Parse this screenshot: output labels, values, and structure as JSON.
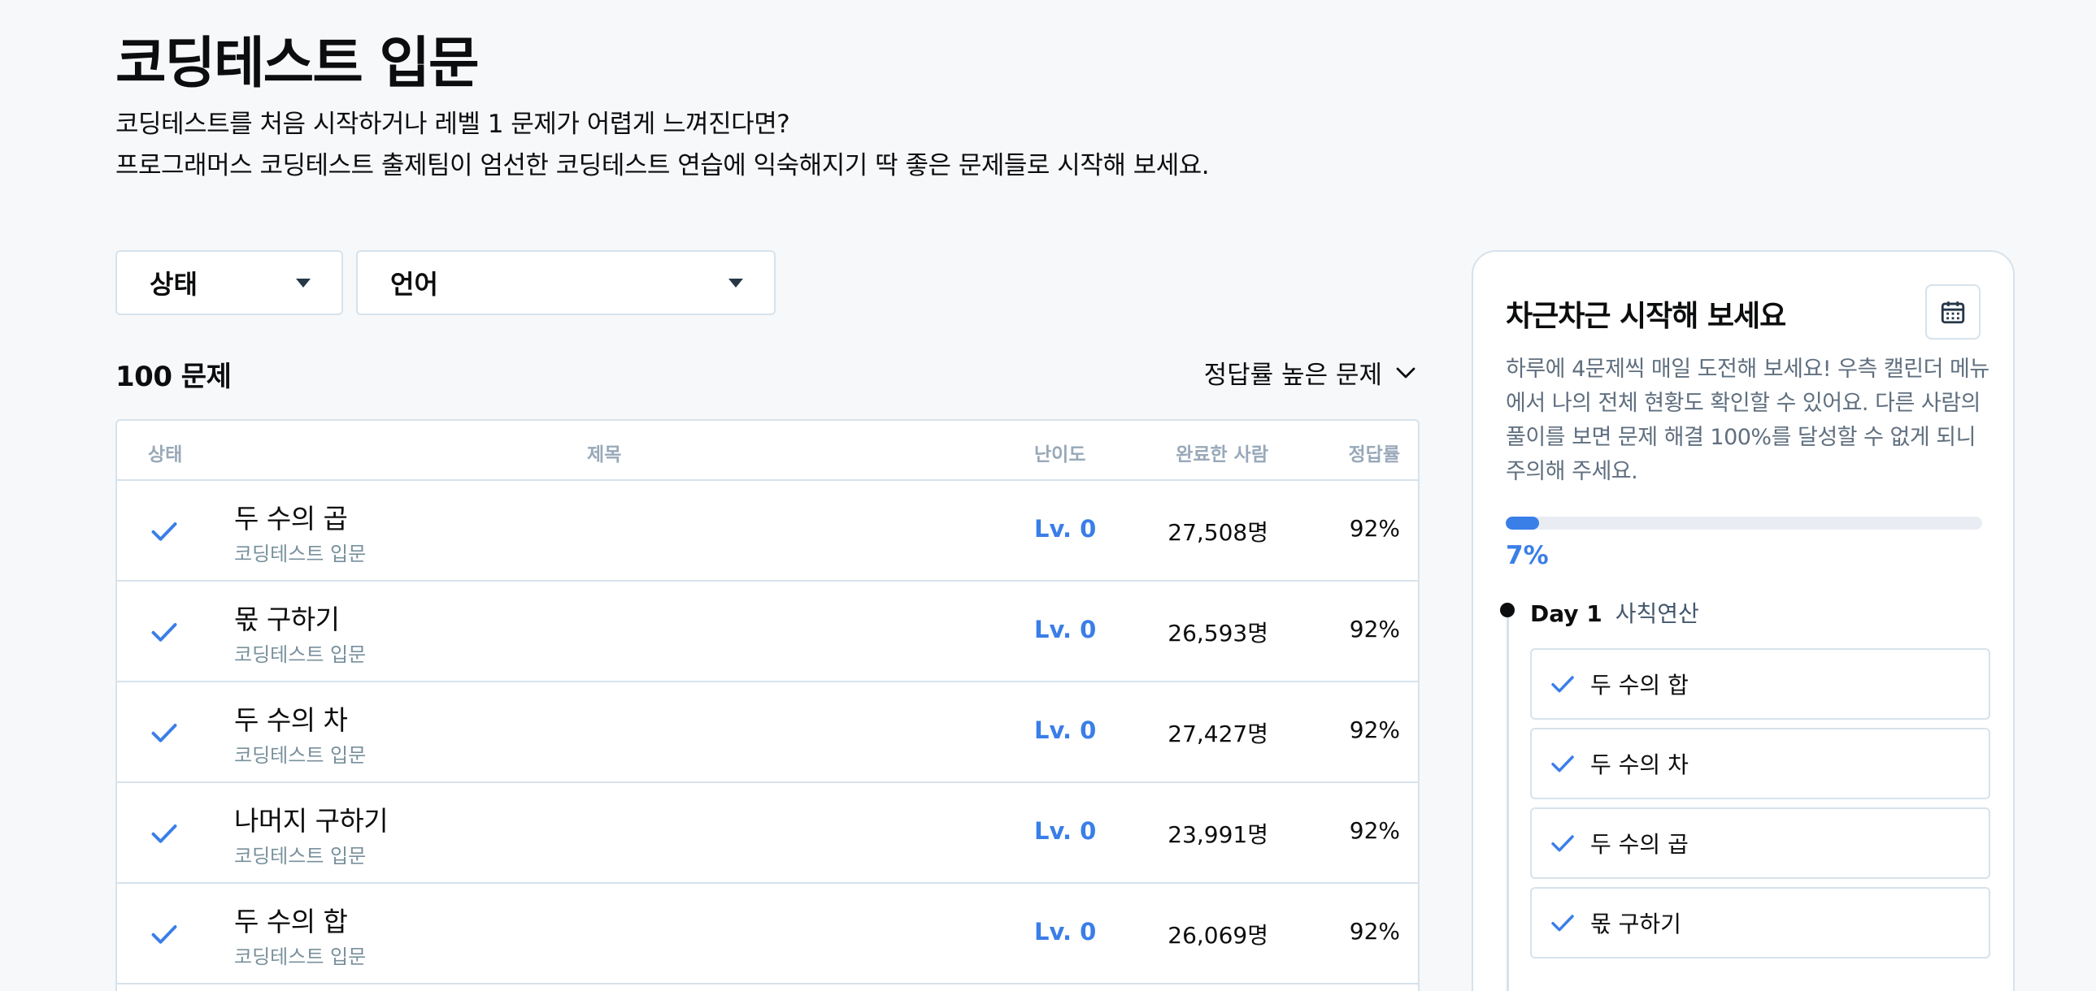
{
  "page": {
    "title": "코딩테스트 입문",
    "description_lines": [
      "코딩테스트를 처음 시작하거나 레벨 1 문제가 어렵게 느껴진다면?",
      "프로그래머스 코딩테스트 출제팀이 엄선한 코딩테스트 연습에 익숙해지기 딱 좋은 문제들로 시작해 보세요."
    ]
  },
  "filters": {
    "status_label": "상태",
    "language_label": "언어"
  },
  "list": {
    "count_label": "100 문제",
    "sort_label": "정답률 높은 문제"
  },
  "table": {
    "headers": {
      "status": "상태",
      "title": "제목",
      "level": "난이도",
      "completed": "완료한 사람",
      "rate": "정답률"
    },
    "rows": [
      {
        "title": "두 수의 곱",
        "category": "코딩테스트 입문",
        "level": "Lv. 0",
        "completed": "27,508명",
        "rate": "92%"
      },
      {
        "title": "몫 구하기",
        "category": "코딩테스트 입문",
        "level": "Lv. 0",
        "completed": "26,593명",
        "rate": "92%"
      },
      {
        "title": "두 수의 차",
        "category": "코딩테스트 입문",
        "level": "Lv. 0",
        "completed": "27,427명",
        "rate": "92%"
      },
      {
        "title": "나머지 구하기",
        "category": "코딩테스트 입문",
        "level": "Lv. 0",
        "completed": "23,991명",
        "rate": "92%"
      },
      {
        "title": "두 수의 합",
        "category": "코딩테스트 입문",
        "level": "Lv. 0",
        "completed": "26,069명",
        "rate": "92%"
      }
    ]
  },
  "panel": {
    "title": "차근차근 시작해 보세요",
    "description": "하루에 4문제씩 매일 도전해 보세요! 우측 캘린더 메뉴에서 나의 전체 현황도 확인할 수 있어요. 다른 사람의 풀이를 보면 문제 해결 100%를 달성할 수 없게 되니 주의해 주세요.",
    "progress_percent": 7,
    "progress_label": "7%",
    "day": "Day 1",
    "topic": "사칙연산",
    "tasks": [
      "두 수의 합",
      "두 수의 차",
      "두 수의 곱",
      "몫 구하기"
    ]
  },
  "colors": {
    "accent": "#3a7ee8",
    "border": "#d7e2eb",
    "muted": "#98a8b9"
  },
  "icons": {
    "check": "check-icon",
    "calendar": "calendar-icon",
    "chevron": "chevron-down-icon",
    "caret": "caret-down-icon"
  }
}
